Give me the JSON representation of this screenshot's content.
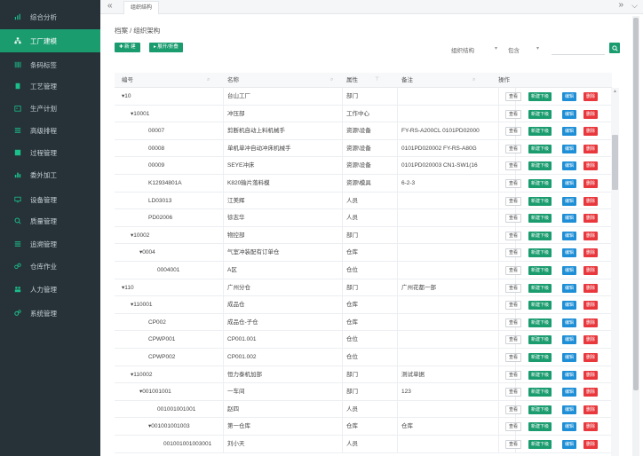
{
  "colors": {
    "sidebar_bg": "#263238",
    "accent_green": "#1a9c6f",
    "edit_blue": "#1e8fd6",
    "delete_red": "#e8383d"
  },
  "sidebar": {
    "items": [
      {
        "label": "综合分析",
        "icon": "bar-chart-icon",
        "active": false
      },
      {
        "label": "工厂建模",
        "icon": "org-tree-icon",
        "active": true
      },
      {
        "label": "条码标签",
        "icon": "barcode-icon",
        "active": false
      },
      {
        "label": "工艺管理",
        "icon": "document-icon",
        "active": false
      },
      {
        "label": "生产计划",
        "icon": "calendar-icon",
        "active": false
      },
      {
        "label": "高级排程",
        "icon": "list-icon",
        "active": false
      },
      {
        "label": "过程管理",
        "icon": "process-icon",
        "active": false
      },
      {
        "label": "委外加工",
        "icon": "outsource-chart-icon",
        "active": false
      },
      {
        "label": "设备管理",
        "icon": "monitor-icon",
        "active": false
      },
      {
        "label": "质量管理",
        "icon": "search-quality-icon",
        "active": false
      },
      {
        "label": "追溯管理",
        "icon": "trace-list-icon",
        "active": false
      },
      {
        "label": "仓库作业",
        "icon": "warehouse-icon",
        "active": false
      },
      {
        "label": "人力管理",
        "icon": "people-icon",
        "active": false
      },
      {
        "label": "系统管理",
        "icon": "gears-icon",
        "active": false
      }
    ]
  },
  "topbar": {
    "tab_label": "组织结构",
    "nav_left": "«",
    "nav_right": "»",
    "nav_down": "⌵"
  },
  "breadcrumb": "档案 / 组织架构",
  "toolbar": {
    "new_label": "✚ 新 建",
    "expand_label": "▸ 展开/折叠"
  },
  "filter": {
    "field_select": "组织结构",
    "op_select": "包含",
    "value": ""
  },
  "table": {
    "headers": {
      "code": "编号",
      "name": "名称",
      "attr": "属性",
      "remark": "备注",
      "actions": "操作"
    },
    "action_labels": {
      "view": "查看",
      "add_sub": "新建下级",
      "edit": "编辑",
      "delete": "删除"
    },
    "rows": [
      {
        "code": "▾10",
        "name": "台山工厂",
        "attr": "部门",
        "remark": "",
        "level": 0
      },
      {
        "code": "▾10001",
        "name": "冲压部",
        "attr": "工作中心",
        "remark": "",
        "level": 1
      },
      {
        "code": "00007",
        "name": "剪断机自动上料机械手",
        "attr": "资源\\设备",
        "remark": "FY-RS-A200CL 0101PD02000",
        "level": 2
      },
      {
        "code": "00008",
        "name": "单机单冲自动冲床机械手",
        "attr": "资源\\设备",
        "remark": "0101PD020002 FY-RS-A80G",
        "level": 2
      },
      {
        "code": "00009",
        "name": "SEYE冲床",
        "attr": "资源\\设备",
        "remark": "0101PD020003 CN1-SW1(16",
        "level": 2
      },
      {
        "code": "K12934801A",
        "name": "K820输片落料模",
        "attr": "资源\\模具",
        "remark": "6-2-3",
        "level": 2
      },
      {
        "code": "LD03013",
        "name": "江美辉",
        "attr": "人员",
        "remark": "",
        "level": 2
      },
      {
        "code": "PD02006",
        "name": "徐志华",
        "attr": "人员",
        "remark": "",
        "level": 2
      },
      {
        "code": "▾10002",
        "name": "物控部",
        "attr": "部门",
        "remark": "",
        "level": 1
      },
      {
        "code": "▾0004",
        "name": "气室冲装配有订单仓",
        "attr": "仓库",
        "remark": "",
        "level": 2
      },
      {
        "code": "0004001",
        "name": "A区",
        "attr": "仓位",
        "remark": "",
        "level": 3
      },
      {
        "code": "▾110",
        "name": "广州分仓",
        "attr": "部门",
        "remark": "广州花都一部",
        "level": 0
      },
      {
        "code": "▾110001",
        "name": "成品仓",
        "attr": "仓库",
        "remark": "",
        "level": 1
      },
      {
        "code": "CP002",
        "name": "成品仓-子仓",
        "attr": "仓库",
        "remark": "",
        "level": 2
      },
      {
        "code": "CPWP001",
        "name": "CP001.001",
        "attr": "仓位",
        "remark": "",
        "level": 2
      },
      {
        "code": "CPWP002",
        "name": "CP001.002",
        "attr": "仓位",
        "remark": "",
        "level": 2
      },
      {
        "code": "▾110002",
        "name": "恒力泰机加部",
        "attr": "部门",
        "remark": "测试单据",
        "level": 1
      },
      {
        "code": "▾001001001",
        "name": "一车间",
        "attr": "部门",
        "remark": "123",
        "level": 2
      },
      {
        "code": "001001001001",
        "name": "赵四",
        "attr": "人员",
        "remark": "",
        "level": 3
      },
      {
        "code": "▾001001001003",
        "name": "第一仓库",
        "attr": "仓库",
        "remark": "仓库",
        "level": 3
      },
      {
        "code": "001001001003001",
        "name": "刘小天",
        "attr": "人员",
        "remark": "",
        "level": 4
      }
    ]
  }
}
